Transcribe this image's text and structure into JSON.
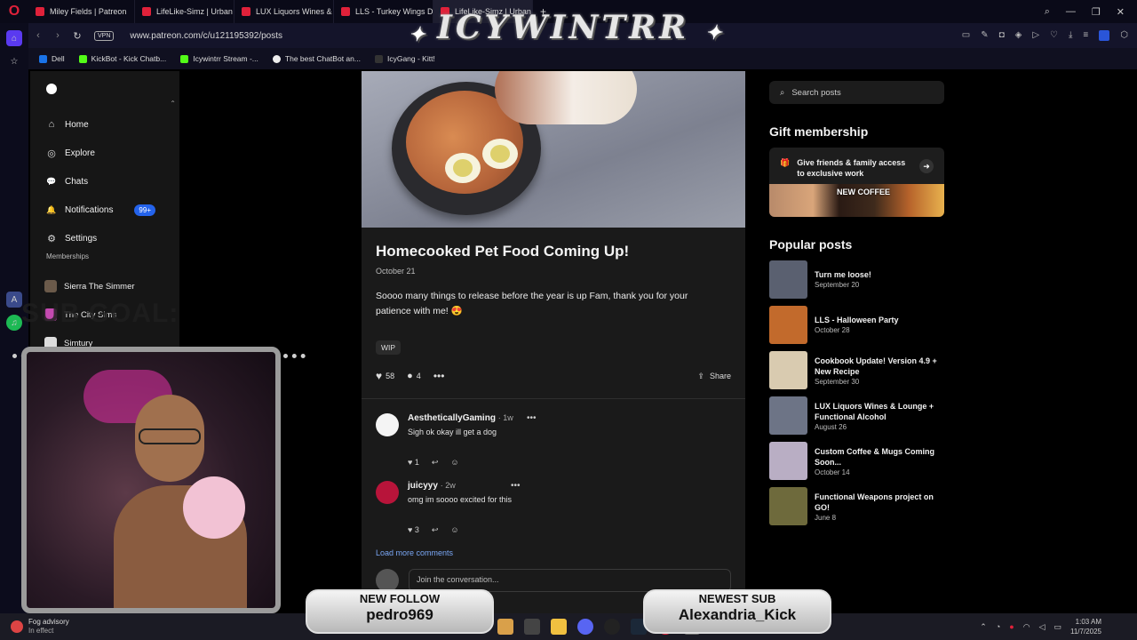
{
  "browser": {
    "tabs": [
      {
        "label": "Miley Fields | Patreon",
        "color": "#e0213a"
      },
      {
        "label": "LifeLike-Simz | Urban Cor",
        "color": "#e0213a"
      },
      {
        "label": "LUX Liquors Wines & Lou",
        "color": "#e0213a"
      },
      {
        "label": "LLS - Turkey Wings Dinn",
        "color": "#e0213a"
      },
      {
        "label": "LifeLike-Simz | Urban Co",
        "color": "#e0213a"
      }
    ],
    "vpn_label": "VPN",
    "url": "www.patreon.com/c/u121195392/posts",
    "bookmarks": [
      "Dell",
      "KickBot - Kick Chatb...",
      "Icywintrr Stream -...",
      "The best ChatBot an...",
      "IcyGang - Kitt!"
    ]
  },
  "sidebar": {
    "nav": [
      {
        "label": "Home",
        "icon": "home-icon",
        "glyph": "⌂"
      },
      {
        "label": "Explore",
        "icon": "compass-icon",
        "glyph": "◎"
      },
      {
        "label": "Chats",
        "icon": "chat-icon",
        "glyph": "💬"
      },
      {
        "label": "Notifications",
        "icon": "bell-icon",
        "glyph": "🔔",
        "badge": "99+"
      },
      {
        "label": "Settings",
        "icon": "gear-icon",
        "glyph": "⚙"
      }
    ],
    "memberships_heading": "Memberships",
    "memberships": [
      {
        "label": "Sierra The Simmer",
        "color": "#6b5a4a"
      },
      {
        "label": "The City Sims",
        "color": "#c44ab0"
      },
      {
        "label": "Simtury",
        "color": "#ddd"
      }
    ]
  },
  "post": {
    "title": "Homecooked Pet Food Coming Up!",
    "date": "October 21",
    "text": "Soooo many things to release before the year is up Fam, thank you for your patience with me! 😍",
    "tag": "WIP",
    "likes": "58",
    "comments": "4",
    "share_label": "Share"
  },
  "comments": [
    {
      "name": "AestheticallyGaming",
      "time": "· 1w",
      "text": "Sigh ok okay ill get a dog",
      "likes": "1",
      "avatar_color": "#f4f4f4"
    },
    {
      "name": "juicyyy",
      "time": "· 2w",
      "text": "omg im soooo excited for this",
      "likes": "3",
      "avatar_color": "#b8143a"
    }
  ],
  "load_more": "Load more comments",
  "join_placeholder": "Join the conversation...",
  "right": {
    "search_placeholder": "Search posts",
    "gift_heading": "Gift membership",
    "gift_text": "Give friends & family access to exclusive work",
    "gift_image_text": "NEW COFFEE",
    "popular_heading": "Popular posts",
    "popular": [
      {
        "title": "Turn me loose!",
        "date": "September 20",
        "color": "#5a6070"
      },
      {
        "title": "LLS - Halloween Party",
        "date": "October 28",
        "color": "#c26a2c"
      },
      {
        "title": "Cookbook Update! Version 4.9 + New Recipe",
        "date": "September 30",
        "color": "#d9cbb0"
      },
      {
        "title": "LUX Liquors Wines & Lounge + Functional Alcohol",
        "date": "August 26",
        "color": "#6d7486"
      },
      {
        "title": "Custom Coffee & Mugs Coming Soon...",
        "date": "October 14",
        "color": "#b9aec4"
      },
      {
        "title": "Functional Weapons project on GO!",
        "date": "June 8",
        "color": "#6e6a3c"
      }
    ]
  },
  "overlay": {
    "watermark": "ICYWINTRR",
    "subgoal": "SUB GOAL:",
    "new_follow_label": "NEW FOLLOW",
    "new_follow_name": "pedro969",
    "newest_sub_label": "NEWEST SUB",
    "newest_sub_name": "Alexandria_Kick"
  },
  "taskbar": {
    "weather_title": "Fog advisory",
    "weather_sub": "In effect",
    "time": "1:03 AM",
    "date": "11/7/2025"
  },
  "colors": {
    "accent_blue": "#2463eb",
    "link_blue": "#7aa7f5",
    "opera_red": "#e0213a"
  }
}
